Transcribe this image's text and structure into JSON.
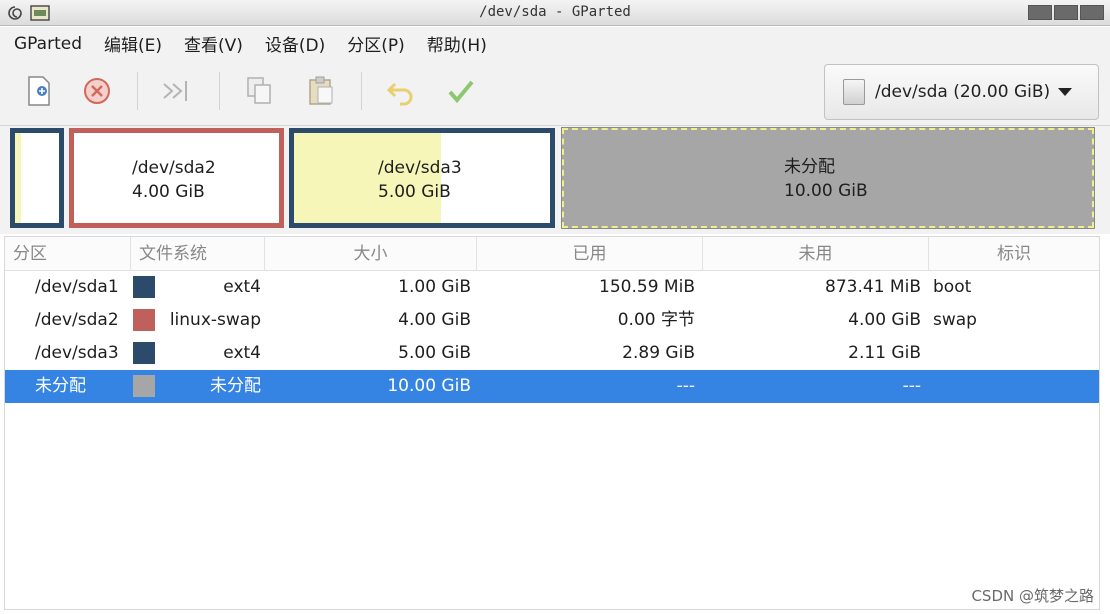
{
  "window": {
    "title": "/dev/sda - GParted"
  },
  "icons": {
    "system_menu": "swirl-icon",
    "app": "gparted-app-icon"
  },
  "menu": [
    {
      "label": "GParted"
    },
    {
      "label": "编辑(E)"
    },
    {
      "label": "查看(V)"
    },
    {
      "label": "设备(D)"
    },
    {
      "label": "分区(P)"
    },
    {
      "label": "帮助(H)"
    }
  ],
  "toolbar": {
    "tools": [
      "new-partition-icon",
      "delete-icon",
      "resize-move-icon",
      "copy-icon",
      "paste-icon",
      "undo-icon",
      "apply-icon"
    ],
    "device_label": "/dev/sda (20.00 GiB)"
  },
  "visualization": {
    "sda2": {
      "name": "/dev/sda2",
      "size": "4.00 GiB"
    },
    "sda3": {
      "name": "/dev/sda3",
      "size": "5.00 GiB"
    },
    "unallocated": {
      "name": "未分配",
      "size": "10.00 GiB"
    }
  },
  "table": {
    "columns": {
      "partition": "分区",
      "filesystem": "文件系统",
      "size": "大小",
      "used": "已用",
      "unused": "未用",
      "flags": "标识"
    },
    "rows": [
      {
        "partition": "/dev/sda1",
        "color": "#2c4a6a",
        "filesystem": "ext4",
        "size": "1.00 GiB",
        "used": "150.59 MiB",
        "unused": "873.41 MiB",
        "flags": "boot"
      },
      {
        "partition": "/dev/sda2",
        "color": "#c0605a",
        "filesystem": "linux-swap",
        "size": "4.00 GiB",
        "used": "0.00 字节",
        "unused": "4.00 GiB",
        "flags": "swap"
      },
      {
        "partition": "/dev/sda3",
        "color": "#2c4a6a",
        "filesystem": "ext4",
        "size": "5.00 GiB",
        "used": "2.89 GiB",
        "unused": "2.11 GiB",
        "flags": ""
      },
      {
        "partition": "未分配",
        "color": "#a6a6a6",
        "filesystem": "未分配",
        "size": "10.00 GiB",
        "used": "---",
        "unused": "---",
        "flags": ""
      }
    ],
    "selected_row": 3
  },
  "colors": {
    "selection": "#3584e4",
    "ext4": "#2c4a6a",
    "linux_swap": "#c0605a",
    "unallocated": "#a6a6a6",
    "used_fill": "#f6f6b8"
  },
  "watermark": "CSDN @筑梦之路"
}
